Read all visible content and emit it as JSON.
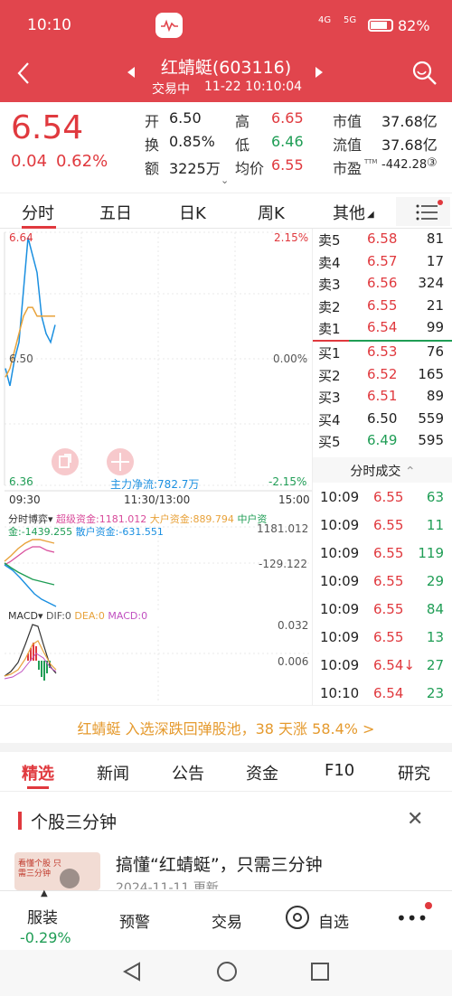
{
  "status": {
    "time": "10:10",
    "net1": "4G",
    "net2": "5G",
    "battery": "82%"
  },
  "header": {
    "title": "红蜻蜓(603116)",
    "status": "交易中",
    "datetime": "11-22 10:10:04"
  },
  "quote": {
    "price": "6.54",
    "change": "0.04",
    "change_pct": "0.62%",
    "stats": [
      {
        "label": "开",
        "value": "6.50",
        "color": "blk"
      },
      {
        "label": "高",
        "value": "6.65",
        "color": "red"
      },
      {
        "label": "市值",
        "value": "37.68亿",
        "color": "blk"
      },
      {
        "label": "换",
        "value": "0.85%",
        "color": "blk"
      },
      {
        "label": "低",
        "value": "6.46",
        "color": "green"
      },
      {
        "label": "流值",
        "value": "37.68亿",
        "color": "blk"
      },
      {
        "label": "额",
        "value": "3225万",
        "color": "blk"
      },
      {
        "label": "均价",
        "value": "6.55",
        "color": "red"
      },
      {
        "label": "市盈",
        "value": "-442.28",
        "color": "blk"
      }
    ],
    "pe_suffix": "TTM",
    "pe_mark": "③"
  },
  "tabs": [
    "分时",
    "五日",
    "日K",
    "周K",
    "其他"
  ],
  "chart": {
    "top_price": "6.64",
    "top_pct": "2.15%",
    "mid_price": "6.50",
    "mid_pct": "0.00%",
    "bot_price": "6.36",
    "bot_pct": "-2.15%",
    "net_flow": "主力净流:782.7万",
    "t_start": "09:30",
    "t_mid": "11:30/13:00",
    "t_end": "15:00",
    "boyi_label": "分时博弈",
    "boyi_items": [
      "超级资金:1181.012",
      "大户资金:889.794",
      "中户资",
      "金:-1439.255",
      "散户资金:-631.551"
    ],
    "boyi_high": "1181.012",
    "boyi_low": "-129.122",
    "macd_label": "MACD",
    "macd_items": [
      "DIF:0",
      "DEA:0",
      "MACD:0"
    ],
    "macd_high": "0.032",
    "macd_low": "0.006"
  },
  "chart_data": {
    "type": "line",
    "title": "",
    "xlabel": "",
    "ylabel": "",
    "ylim": [
      6.36,
      6.64
    ],
    "series": [
      {
        "name": "",
        "values": [
          6.49,
          6.47,
          6.5,
          6.52,
          6.58,
          6.64,
          6.62,
          6.6,
          6.55,
          6.53,
          6.52,
          6.54
        ]
      },
      {
        "name": "",
        "values": [
          6.48,
          6.49,
          6.51,
          6.53,
          6.55,
          6.56,
          6.56,
          6.55,
          6.55,
          6.55,
          6.55,
          6.55
        ]
      }
    ]
  },
  "book": {
    "asks": [
      {
        "label": "卖5",
        "price": "6.58",
        "vol": "81",
        "color": "red"
      },
      {
        "label": "卖4",
        "price": "6.57",
        "vol": "17",
        "color": "red"
      },
      {
        "label": "卖3",
        "price": "6.56",
        "vol": "324",
        "color": "red"
      },
      {
        "label": "卖2",
        "price": "6.55",
        "vol": "21",
        "color": "red"
      },
      {
        "label": "卖1",
        "price": "6.54",
        "vol": "99",
        "color": "red"
      }
    ],
    "bids": [
      {
        "label": "买1",
        "price": "6.53",
        "vol": "76",
        "color": "red"
      },
      {
        "label": "买2",
        "price": "6.52",
        "vol": "165",
        "color": "red"
      },
      {
        "label": "买3",
        "price": "6.51",
        "vol": "89",
        "color": "red"
      },
      {
        "label": "买4",
        "price": "6.50",
        "vol": "559",
        "color": "blk"
      },
      {
        "label": "买5",
        "price": "6.49",
        "vol": "595",
        "color": "green"
      }
    ],
    "trades_header": "分时成交",
    "trades": [
      {
        "time": "10:09",
        "price": "6.55",
        "vol": "63",
        "vcolor": "green"
      },
      {
        "time": "10:09",
        "price": "6.55",
        "vol": "11",
        "vcolor": "green"
      },
      {
        "time": "10:09",
        "price": "6.55",
        "vol": "119",
        "vcolor": "green"
      },
      {
        "time": "10:09",
        "price": "6.55",
        "vol": "29",
        "vcolor": "green"
      },
      {
        "time": "10:09",
        "price": "6.55",
        "vol": "84",
        "vcolor": "green"
      },
      {
        "time": "10:09",
        "price": "6.55",
        "vol": "13",
        "vcolor": "green"
      },
      {
        "time": "10:09",
        "price": "6.54↓",
        "vol": "27",
        "vcolor": "green"
      },
      {
        "time": "10:10",
        "price": "6.54",
        "vol": "23",
        "vcolor": "green"
      }
    ]
  },
  "banner": "红蜻蜓 入选深跌回弹股池，38 天涨 58.4% >",
  "news_tabs": [
    "精选",
    "新闻",
    "公告",
    "资金",
    "F10",
    "研究"
  ],
  "article": {
    "section": "个股三分钟",
    "title": "搞懂“红蜻蜓”，只需三分钟",
    "date": "2024-11-11 更新",
    "thumb": "看懂个股 只需三分钟"
  },
  "bottom": {
    "sector": "服装",
    "sector_pct": "-0.29%",
    "alert": "预警",
    "trade": "交易",
    "watch": "自选",
    "more": "•••"
  },
  "colors": {
    "header": "#e1454d",
    "up": "#e0393e",
    "down": "#1f9d55",
    "avg": "#e8a23a",
    "price": "#1a8fe0"
  }
}
